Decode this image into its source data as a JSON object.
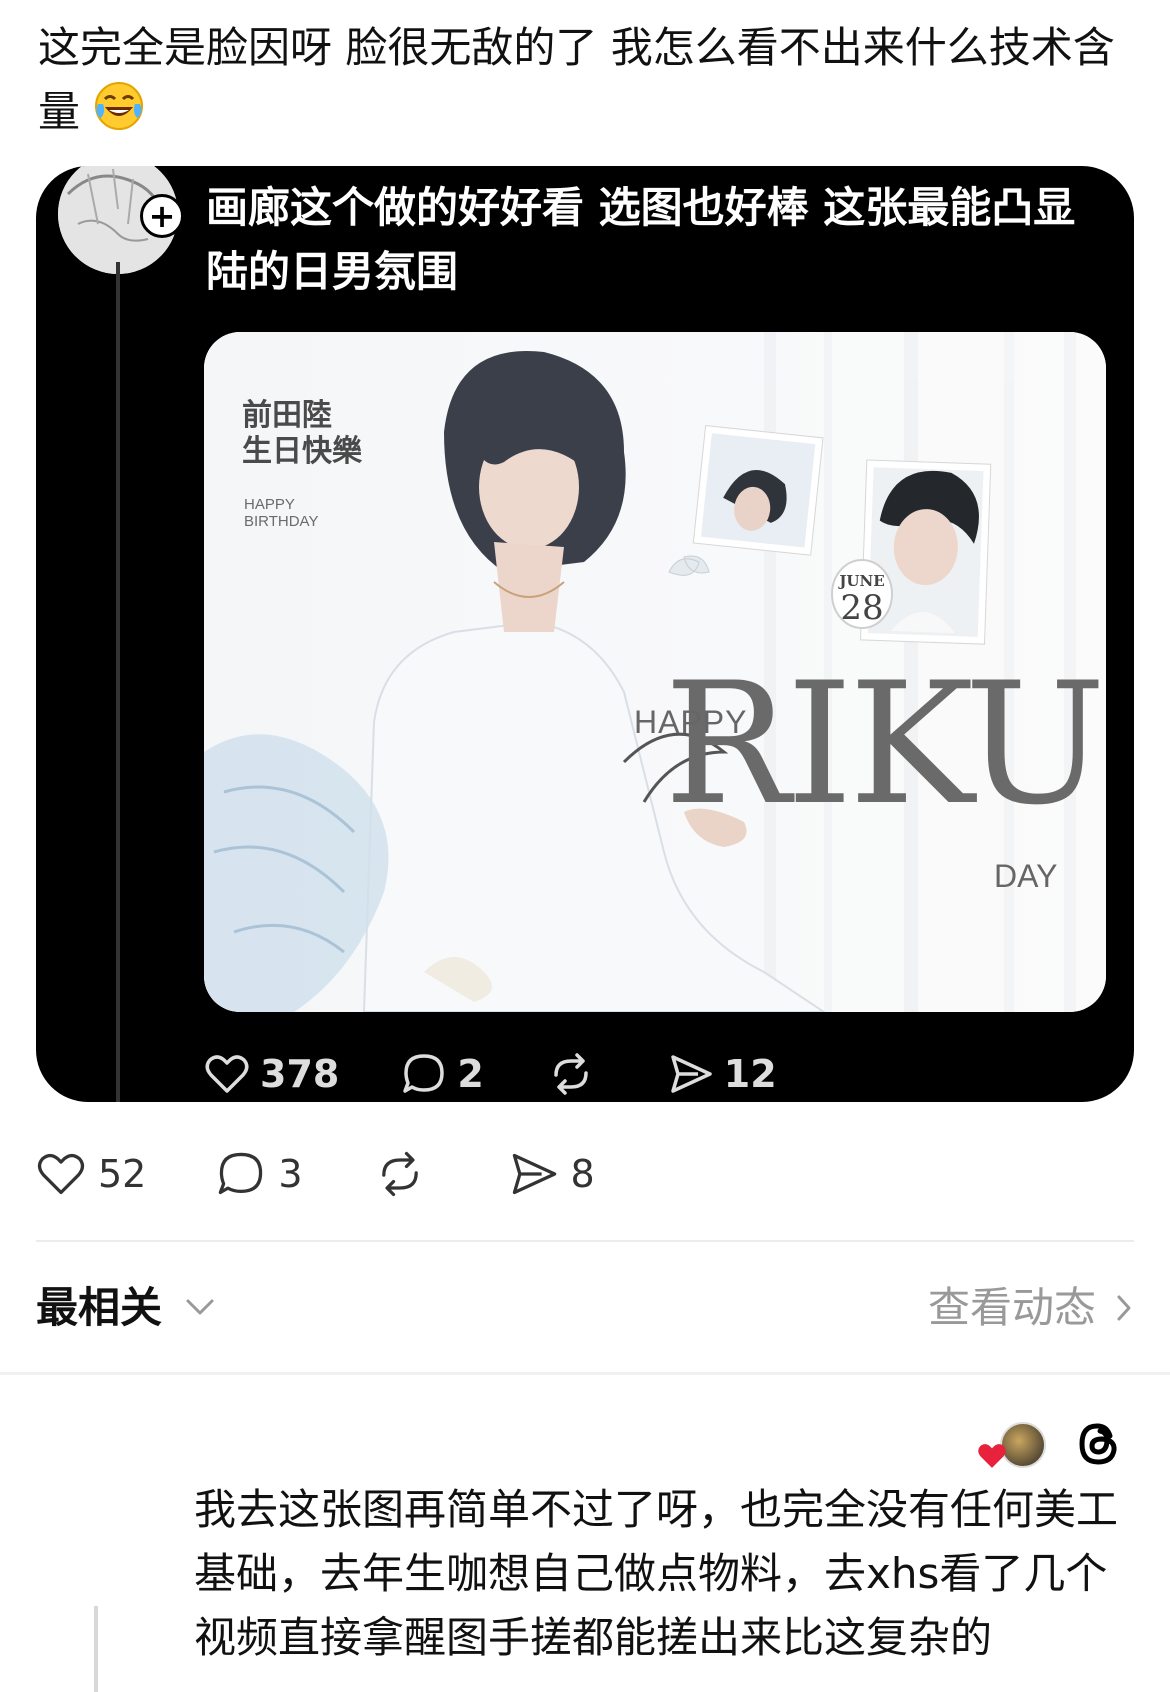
{
  "post": {
    "text": "这完全是脸因呀 脸很无敌的了 我怎么看不出来什么技术含量",
    "emoji": "face-with-tears-of-joy"
  },
  "quoted_post": {
    "text": "画廊这个做的好好看 选图也好棒 这张最能凸显陆的日男氛围",
    "follow_icon": "+",
    "image": {
      "jp_title": "前田陸\n生日快樂",
      "small_text": "HAPPY\nBIRTHDAY",
      "happy": "HAPPY",
      "riku": "RIKU",
      "day": "DAY",
      "june": "JUNE",
      "date": "28"
    },
    "stats": {
      "likes": "378",
      "comments": "2",
      "shares": "12"
    }
  },
  "post_stats": {
    "likes": "52",
    "comments": "3",
    "shares": "8"
  },
  "sort": {
    "label": "最相关",
    "activity_label": "查看动态"
  },
  "reply": {
    "text": "我去这张图再简单不过了呀，也完全没有任何美工基础，去年生咖想自己做点物料，去xhs看了几个视频直接拿醒图手搓都能搓出来比这复杂的"
  },
  "colors": {
    "quote_bg": "#000000",
    "heart_red": "#e8213c",
    "muted": "#999999"
  }
}
